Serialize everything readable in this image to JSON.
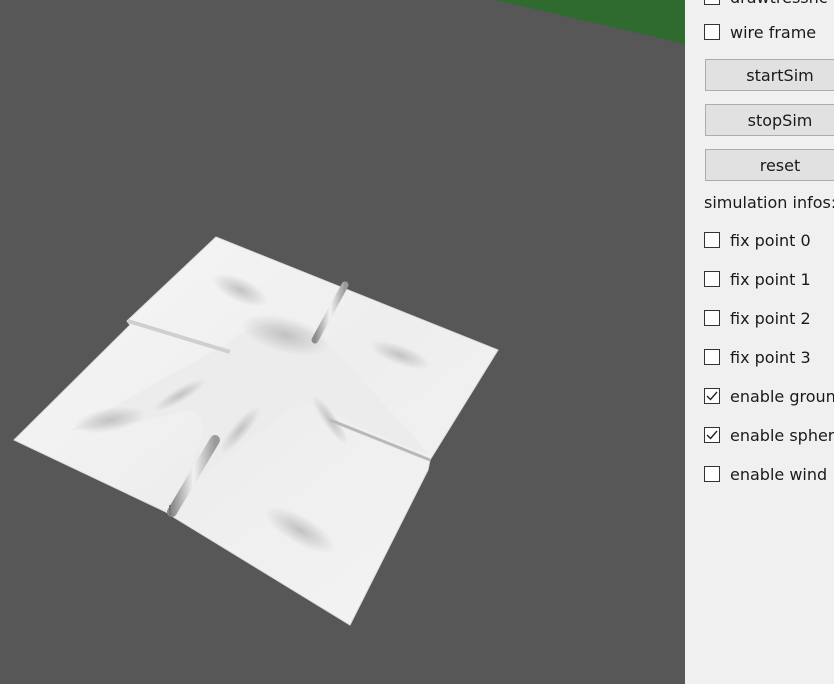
{
  "viewport": {
    "background_color": "#575757",
    "ground_color": "#2f6b2e",
    "cloth_color": "#f2f2f2"
  },
  "panel": {
    "cut_top_label": "drawtresshc",
    "wireframe": {
      "label": "wire frame",
      "checked": false
    },
    "buttons": {
      "start": "startSim",
      "stop": "stopSim",
      "reset": "reset"
    },
    "info_label": "simulation infos:",
    "fix_points": [
      {
        "label": "fix point 0",
        "checked": false
      },
      {
        "label": "fix point 1",
        "checked": false
      },
      {
        "label": "fix point 2",
        "checked": false
      },
      {
        "label": "fix point 3",
        "checked": false
      }
    ],
    "enable_ground": {
      "label": "enable ground",
      "checked": true
    },
    "enable_sphere": {
      "label": "enable sphere",
      "checked": true
    },
    "enable_wind": {
      "label": "enable wind",
      "checked": false
    }
  }
}
